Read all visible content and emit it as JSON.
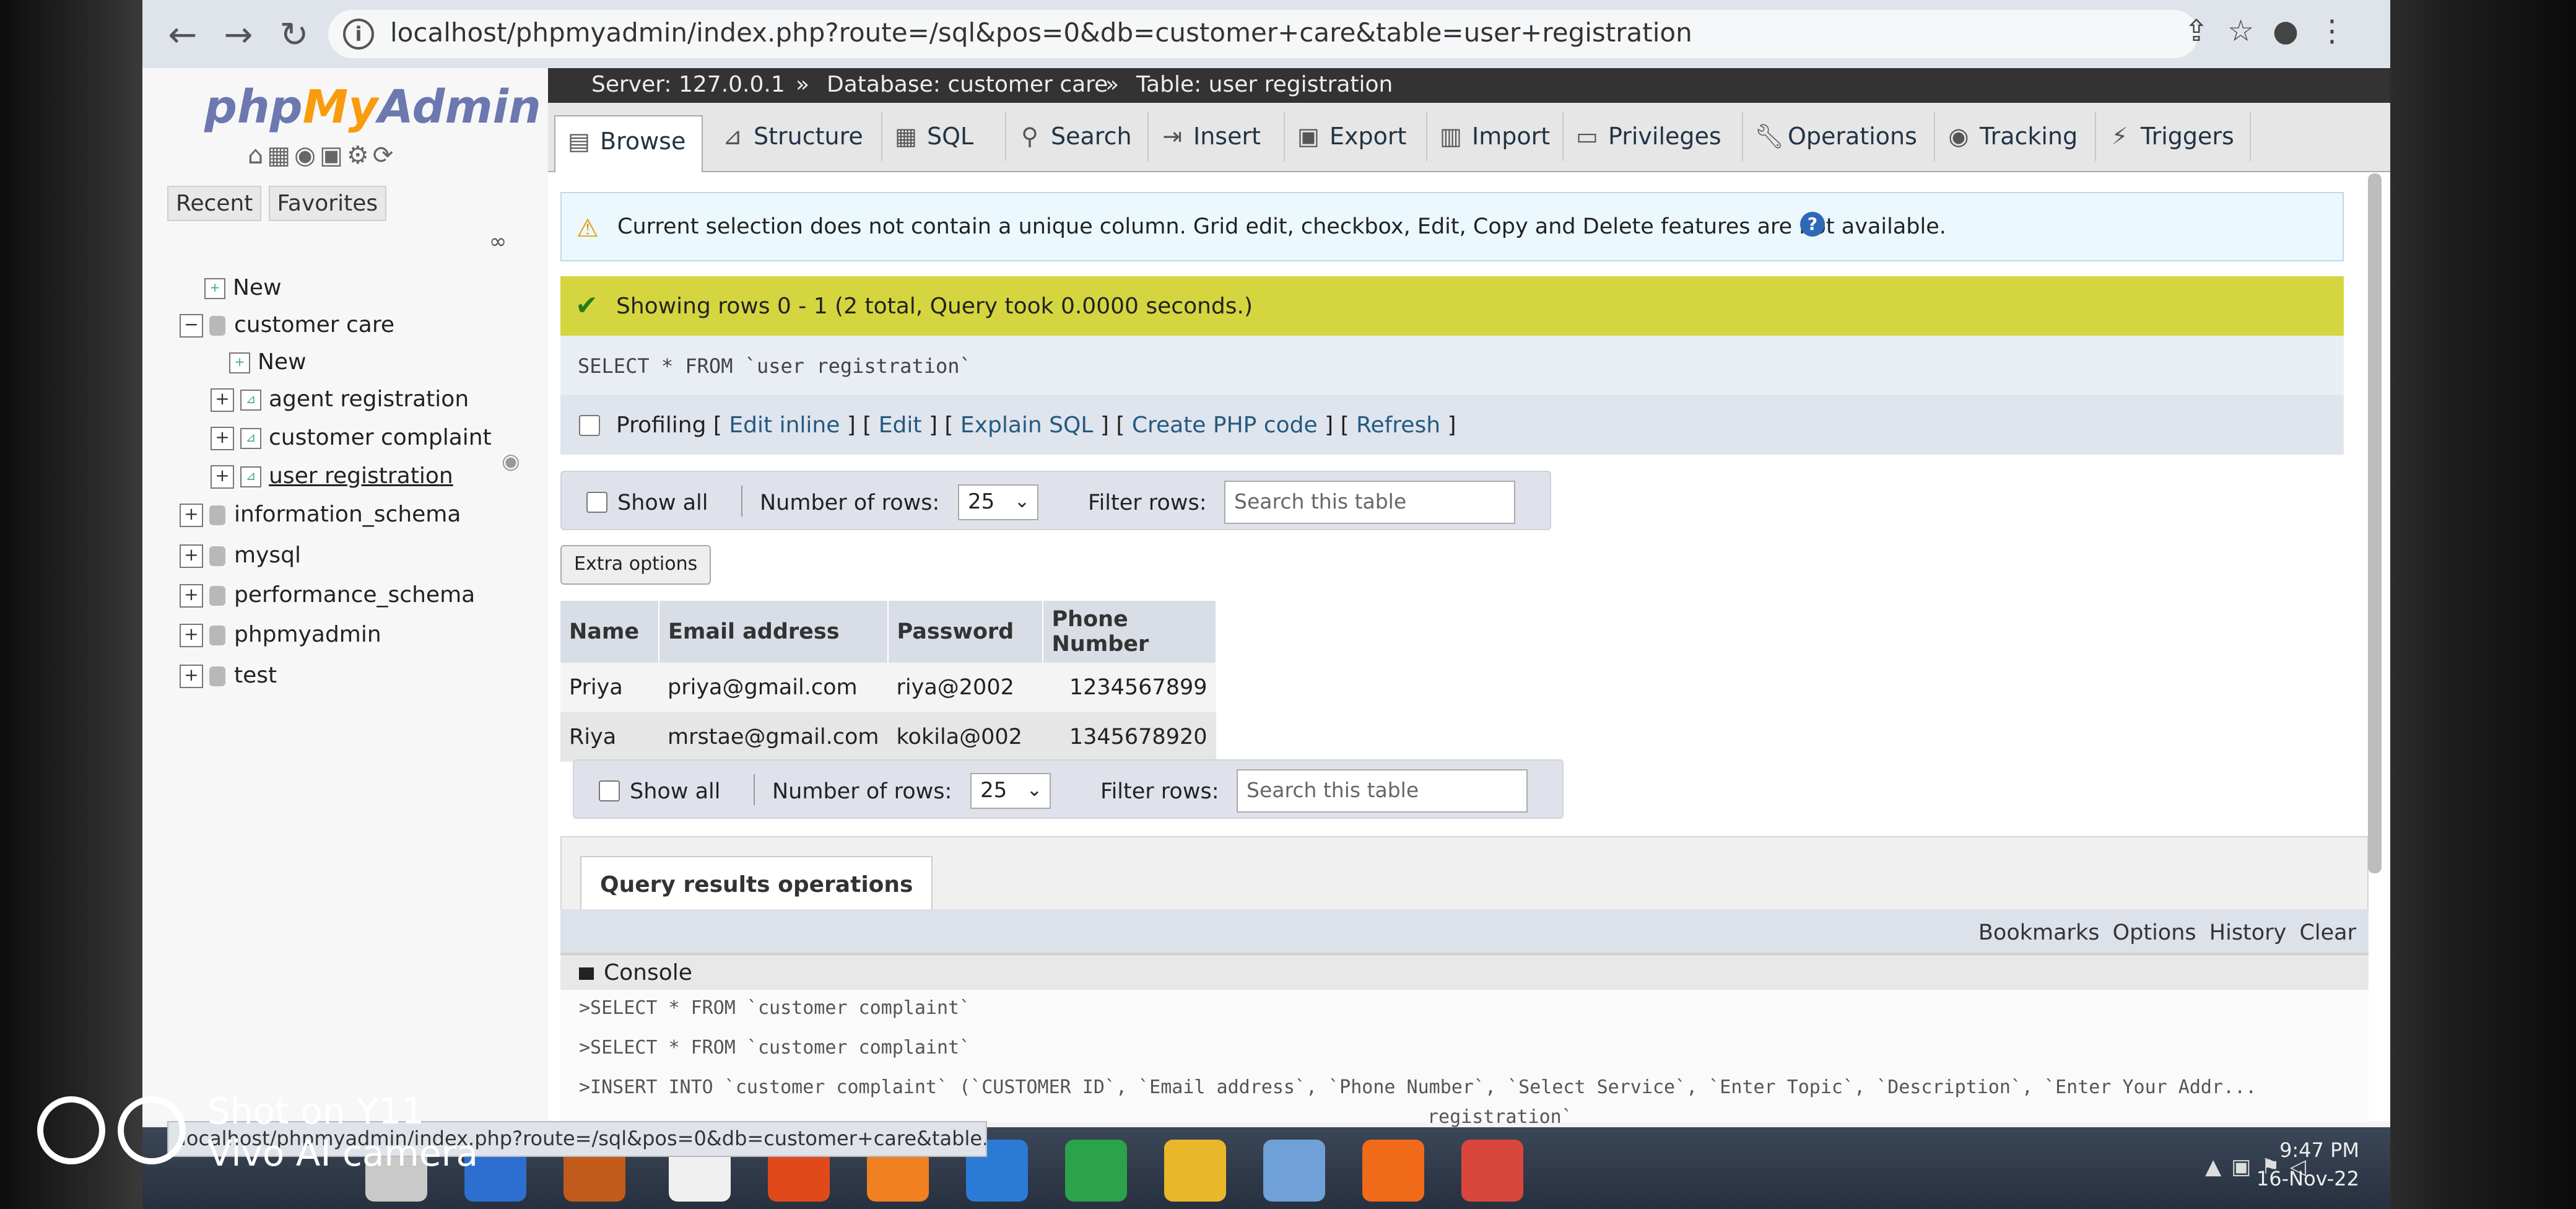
{
  "browser": {
    "url": "localhost/phpmyadmin/index.php?route=/sql&pos=0&db=customer+care&table=user+registration",
    "back_icon": "←",
    "forward_icon": "→",
    "reload_icon": "↻",
    "info_icon": "i"
  },
  "sidebar": {
    "logo_php": "php",
    "logo_my": "My",
    "logo_admin": "Admin",
    "tabs": [
      "Recent",
      "Favorites"
    ],
    "tree": [
      {
        "label": "New",
        "level": 0
      },
      {
        "label": "customer care",
        "level": 0
      },
      {
        "label": "New",
        "level": 1
      },
      {
        "label": "agent registration",
        "level": 1
      },
      {
        "label": "customer complaint",
        "level": 1
      },
      {
        "label": "user registration",
        "level": 1
      },
      {
        "label": "information_schema",
        "level": 0
      },
      {
        "label": "mysql",
        "level": 0
      },
      {
        "label": "performance_schema",
        "level": 0
      },
      {
        "label": "phpmyadmin",
        "level": 0
      },
      {
        "label": "test",
        "level": 0
      }
    ]
  },
  "breadcrumb": {
    "server": "Server: 127.0.0.1",
    "database": "Database: customer care",
    "table": "Table: user registration",
    "sep": "»"
  },
  "tabs": [
    "Browse",
    "Structure",
    "SQL",
    "Search",
    "Insert",
    "Export",
    "Import",
    "Privileges",
    "Operations",
    "Tracking",
    "Triggers"
  ],
  "notice": "Current selection does not contain a unique column. Grid edit, checkbox, Edit, Copy and Delete features are not available.",
  "success": "Showing rows 0 - 1 (2 total, Query took 0.0000 seconds.)",
  "sql": "SELECT * FROM `user registration`",
  "profiling": {
    "label": "Profiling",
    "links": [
      "Edit inline",
      "Edit",
      "Explain SQL",
      "Create PHP code",
      "Refresh"
    ]
  },
  "nav": {
    "show_all": "Show all",
    "num_rows_label": "Number of rows:",
    "num_rows": "25",
    "filter_label": "Filter rows:",
    "filter_placeholder": "Search this table"
  },
  "extra_options": "Extra options",
  "table": {
    "headers": [
      "Name",
      "Email address",
      "Password",
      "Phone Number"
    ],
    "rows": [
      [
        "Priya",
        "priya@gmail.com",
        "riya@2002",
        "1234567899"
      ],
      [
        "Riya",
        "mrstae@gmail.com",
        "kokila@002",
        "1345678920"
      ]
    ]
  },
  "query_results_operations": "Query results operations",
  "console_links": [
    "Bookmarks",
    "Options",
    "History",
    "Clear"
  ],
  "console": {
    "title": "Console",
    "lines": [
      ">SELECT * FROM `customer complaint`",
      ">SELECT * FROM `customer complaint`",
      ">INSERT INTO `customer complaint` (`CUSTOMER ID`, `Email address`, `Phone Number`, `Select Service`, `Enter Topic`, `Description`, `Enter Your Addr...",
      "registration`"
    ]
  },
  "statusbar": "localhost/phpmyadmin/index.php?route=/sql&pos=0&db=customer+care&table...",
  "clock": {
    "time": "9:47 PM",
    "date": "16-Nov-22"
  },
  "watermark": {
    "line1": "Shot on Y11",
    "line2": "Vivo AI camera"
  }
}
